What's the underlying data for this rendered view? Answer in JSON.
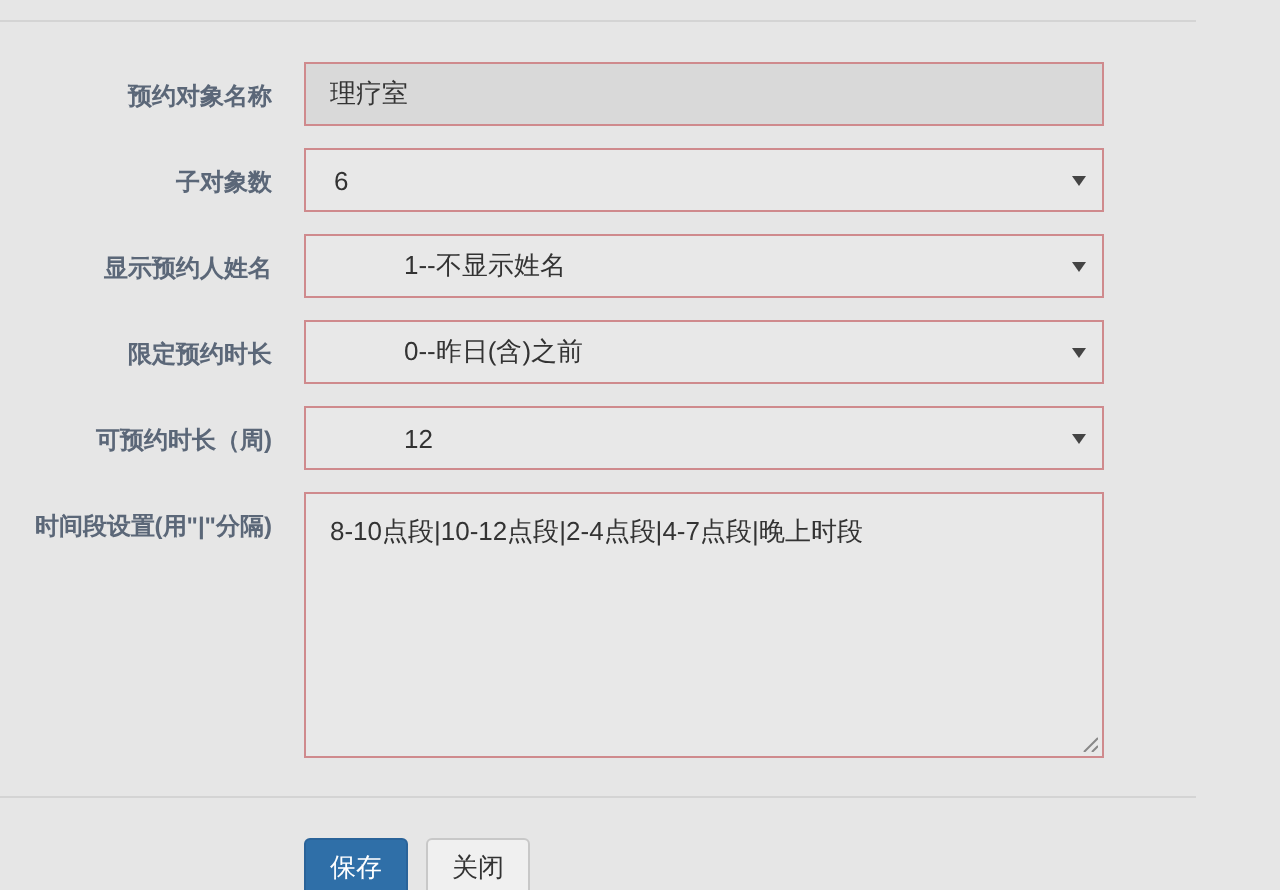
{
  "fields": [
    {
      "label": "预约对象名称",
      "kind": "text",
      "value": "理疗室",
      "readonly": true
    },
    {
      "label": "子对象数",
      "kind": "select",
      "value": "6",
      "indented": false
    },
    {
      "label": "显示预约人姓名",
      "kind": "select",
      "value": "1--不显示姓名",
      "indented": true
    },
    {
      "label": "限定预约时长",
      "kind": "select",
      "value": "0--昨日(含)之前",
      "indented": true
    },
    {
      "label": "可预约时长（周)",
      "kind": "select",
      "value": "12",
      "indented": true
    },
    {
      "label": "时间段设置(用\"|\"分隔)",
      "kind": "textarea",
      "value": "8-10点段|10-12点段|2-4点段|4-7点段|晚上时段"
    }
  ],
  "buttons": [
    {
      "label": "保存",
      "kind": "primary"
    },
    {
      "label": "关闭",
      "kind": "default"
    }
  ]
}
